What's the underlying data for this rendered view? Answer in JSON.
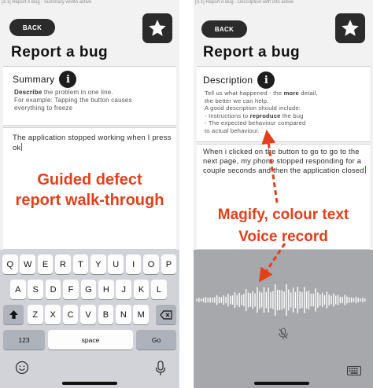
{
  "left": {
    "caption": "[3.1] Report A Bug - Summary w/info active",
    "back_label": "BACK",
    "star_icon": "star-icon",
    "title": "Report a bug",
    "section_label": "Summary",
    "hint_lines": [
      {
        "bold": "Describe",
        "rest": " the problem in one line."
      },
      {
        "bold": "",
        "rest": "For example: Tapping the button causes"
      },
      {
        "bold": "",
        "rest": "everything to freeze"
      }
    ],
    "entry_text": "The application stopped working when I press ok",
    "overlay_line1": "Guided defect",
    "overlay_line2": "report walk-through",
    "keyboard": {
      "row1": [
        "Q",
        "W",
        "E",
        "R",
        "T",
        "Y",
        "U",
        "I",
        "O",
        "P"
      ],
      "row2": [
        "A",
        "S",
        "D",
        "F",
        "G",
        "H",
        "J",
        "K",
        "L"
      ],
      "row3": [
        "Z",
        "X",
        "C",
        "V",
        "B",
        "N",
        "M"
      ],
      "shift_icon": "shift-arrow-icon",
      "backspace_icon": "backspace-icon",
      "numbers_label": "123",
      "space_label": "space",
      "go_label": "Go",
      "emoji_icon": "emoji-icon",
      "mic_icon": "microphone-icon"
    }
  },
  "right": {
    "caption": "[3.1] Report A Bug - Description with info active",
    "back_label": "BACK",
    "star_icon": "star-icon",
    "title": "Report a bug",
    "section_label": "Description",
    "hint_l1_a": "Tell us what happened - the ",
    "hint_l1_b": "more",
    "hint_l1_c": " detail,",
    "hint_l2": "the better we can help.",
    "hint_l3": "A good description should include:",
    "hint_l4_a": "- Instructions to ",
    "hint_l4_b": "reproduce",
    "hint_l4_c": " the bug",
    "hint_l5": "- The expected behaviour compared",
    "hint_l6": "to actual behaviour.",
    "entry_text": "When i clicked on the button to go to go to the next page, my phone stopped responding for a couple seconds and then the application closed",
    "overlay_line1": "Magify, colour text",
    "overlay_line2": "Voice record",
    "mic_off_icon": "microphone-muted-icon",
    "keyboard_icon": "keyboard-icon"
  },
  "colors": {
    "accent": "#e53e1a",
    "button_dark": "#2b2b2b",
    "keyboard_bg": "#d1d3d8",
    "voice_bg": "#a7a8ab"
  }
}
